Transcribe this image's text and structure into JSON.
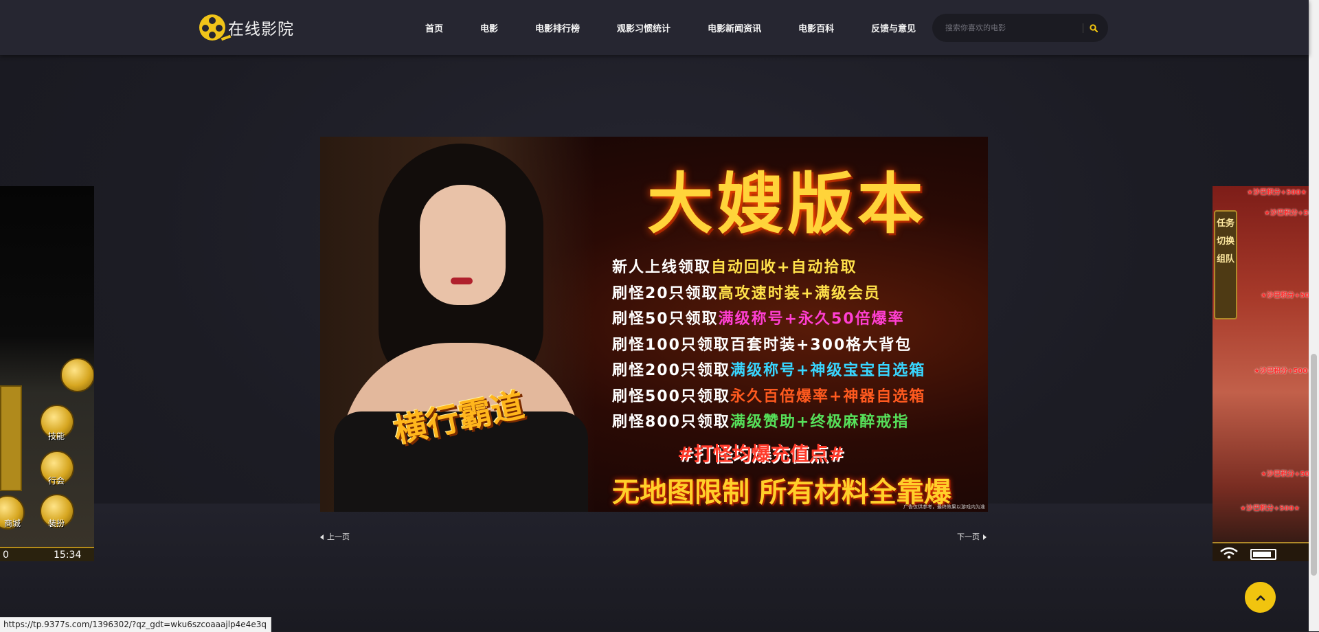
{
  "site": {
    "logo_text": "在线影院"
  },
  "nav": {
    "items": [
      "首页",
      "电影",
      "电影排行榜",
      "观影习惯统计",
      "电影新闻资讯",
      "电影百科",
      "反馈与意见"
    ]
  },
  "search": {
    "placeholder": "搜索你喜欢的电影",
    "icon": "search-icon"
  },
  "slider": {
    "center_ad": {
      "title": "大嫂版本",
      "lines": [
        {
          "prefix": "新人上线领取",
          "highlight": "自动回收+自动拾取",
          "color": "#ffe14a"
        },
        {
          "prefix": "刷怪20只领取",
          "highlight": "高攻速时装+满级会员",
          "color": "#ffe14a"
        },
        {
          "prefix": "刷怪50只领取",
          "highlight": "满级称号+永久50倍爆率",
          "color": "#ff3fd2"
        },
        {
          "prefix": "刷怪100只领取",
          "highlight": "百套时装+300格大背包",
          "color": "#ffffff"
        },
        {
          "prefix": "刷怪200只领取",
          "highlight": "满级称号+神级宝宝自选箱",
          "color": "#38d6ff"
        },
        {
          "prefix": "刷怪500只领取",
          "highlight": "永久百倍爆率+神器自选箱",
          "color": "#ff5a1f"
        },
        {
          "prefix": "刷怪800只领取",
          "highlight": "满级赞助+终极麻醉戒指",
          "color": "#56e05a"
        }
      ],
      "tagline": "#打怪均爆充值点#",
      "slogan": "无地图限制 所有材料全靠爆",
      "stamp": "横行霸道",
      "note": "广告仅供参考，最终效果以游戏内为准"
    },
    "left_ad": {
      "labels": [
        "技能",
        "行会",
        "商城",
        "装扮"
      ],
      "time": "15:34",
      "counter": "0"
    },
    "right_ad": {
      "side_buttons": [
        "任务",
        "切换",
        "组队"
      ],
      "score_text": "★沙巴积分+500★"
    },
    "prev_label": "上一页",
    "next_label": "下一页"
  },
  "status_bar": {
    "url": "https://tp.9377s.com/1396302/?qz_gdt=wku6szcoaaajlp4e4e3q"
  },
  "colors": {
    "accent": "#f1c40f",
    "header_bg": "#262631",
    "page_bg": "#1c1c24"
  }
}
